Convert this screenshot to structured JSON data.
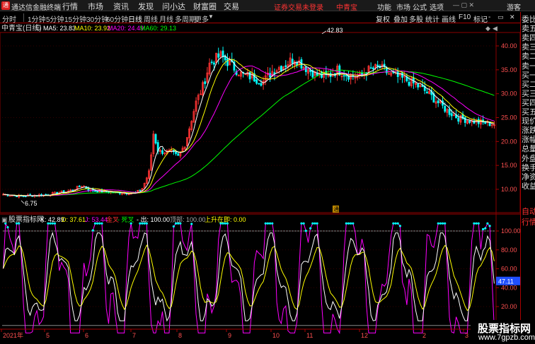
{
  "menubar": {
    "app_title": "通达信金融终端",
    "items": [
      "行情",
      "市场",
      "资讯",
      "发现",
      "问小达",
      "财富圈",
      "交易"
    ],
    "notice": "证券交易未登录",
    "stock_name": "中青宝",
    "right_items": [
      "功能",
      "市场",
      "公式",
      "选项"
    ],
    "visitor": "游客"
  },
  "tabbar": {
    "periods": [
      "分时",
      "1分钟",
      "5分钟",
      "15分钟",
      "30分钟",
      "60分钟",
      "日线",
      "周线",
      "月线",
      "多周期",
      "更多"
    ],
    "active_period": "日线",
    "right_items": [
      "复权",
      "叠加",
      "多股",
      "统计",
      "画线",
      "F10",
      "标记",
      "-"
    ]
  },
  "right_panel": {
    "items": [
      "委比",
      "卖五",
      "卖四",
      "卖三",
      "卖二",
      "卖一",
      "买一",
      "买二",
      "买三",
      "买四",
      "买五",
      "现价",
      "涨跌",
      "涨幅",
      "总量",
      "外盘",
      "换手",
      "净资",
      "收益",
      "自动",
      "行情"
    ]
  },
  "main_chart": {
    "header_title": "中青宝(日线)",
    "ma5_label": "MA5: 23.83",
    "ma10_label": "MA10: 23.92",
    "ma20_label": "MA20: 24.49",
    "ma60_label": "MA60: 29.13",
    "high_label": "42.83",
    "low_label": "6.75",
    "flag_label": "通",
    "y_ticks": [
      "40.00",
      "35.00",
      "30.00",
      "25.00",
      "20.00",
      "15.00",
      "10.00"
    ],
    "colors": {
      "ma5": "#ffffff",
      "ma10": "#ffff00",
      "ma20": "#ff00ff",
      "ma60": "#00ff00",
      "up": "#ff3333",
      "down": "#00ffff"
    }
  },
  "indicator": {
    "name": "股票指标网",
    "k_label": "K: 42.89",
    "d_label": "D: 37.61",
    "j_label": "J: 53.44",
    "gold_label": "金叉",
    "dead_label": "- 死叉",
    "out_label": "- 出: 100.00",
    "top_label": "顶部: 100.00",
    "rise_label": "上升在即: 0.00",
    "y_ticks": [
      "100.00",
      "80.00",
      "60.00",
      "40.00",
      "20.00"
    ],
    "current_value": "47.11"
  },
  "x_axis": {
    "labels": [
      "2021年",
      "5",
      "6",
      "7",
      "8",
      "9",
      "10",
      "11",
      "12",
      "2",
      "3"
    ]
  },
  "watermark": {
    "line1": "股票指标网",
    "line2": "www.7gpzb.com"
  }
}
